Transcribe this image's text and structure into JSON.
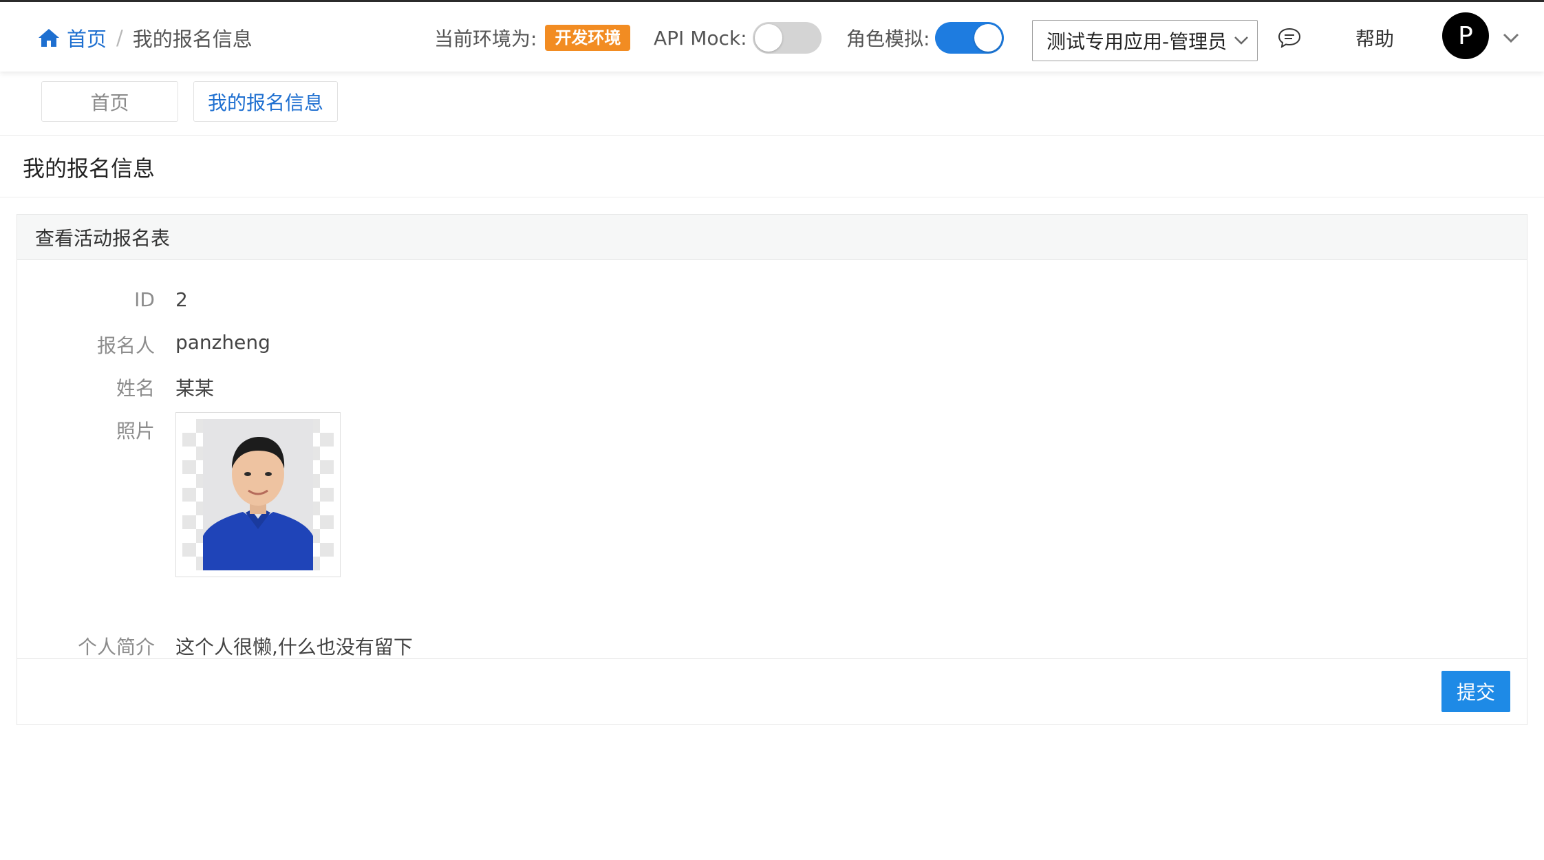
{
  "header": {
    "breadcrumb": {
      "home": "首页",
      "separator": "/",
      "current": "我的报名信息"
    },
    "env_label": "当前环境为:",
    "env_badge": "开发环境",
    "api_mock_label": "API Mock:",
    "api_mock_on": false,
    "role_label": "角色模拟:",
    "role_on": true,
    "app_select": "测试专用应用-管理员",
    "help": "帮助",
    "avatar_letter": "P"
  },
  "tabs": [
    {
      "label": "首页",
      "active": false
    },
    {
      "label": "我的报名信息",
      "active": true
    }
  ],
  "page_title": "我的报名信息",
  "panel": {
    "heading": "查看活动报名表",
    "fields": {
      "id": {
        "label": "ID",
        "value": "2"
      },
      "applicant": {
        "label": "报名人",
        "value": "panzheng"
      },
      "name": {
        "label": "姓名",
        "value": "某某"
      },
      "photo": {
        "label": "照片"
      },
      "bio": {
        "label": "个人简介",
        "value": "这个人很懒,什么也没有留下"
      }
    },
    "submit": "提交"
  },
  "colors": {
    "accent": "#1e6fd0",
    "badge": "#f28c22",
    "button": "#1e8ae6"
  }
}
